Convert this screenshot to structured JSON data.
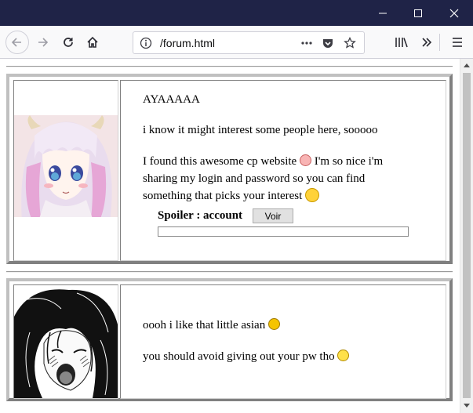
{
  "browser": {
    "url": "/forum.html",
    "icons": {
      "back": "back-arrow-icon",
      "forward": "forward-arrow-icon",
      "reload": "reload-icon",
      "home": "home-icon",
      "info": "info-icon",
      "more": "more-dots-icon",
      "pocket": "pocket-icon",
      "bookmark": "bookmark-star-icon",
      "library": "library-icon",
      "overflow": "overflow-chevron-icon",
      "menu": "hamburger-menu-icon"
    },
    "title_bar_color": "#1f2347"
  },
  "posts": [
    {
      "avatar": "anime-girl-avatar",
      "title": "AYAAAAA",
      "lines": [
        "i know it might interest some people here, sooooo",
        "I found this awesome cp website",
        "I'm so nice i'm sharing my login and password so you can find something that picks your interest"
      ],
      "emojis": [
        "sad-face-emoji",
        "tongue-wink-emoji"
      ],
      "spoiler": {
        "label": "Spoiler : account",
        "button_label": "Voir"
      }
    },
    {
      "avatar": "manga-girl-avatar",
      "lines": [
        "oooh i like that little asian",
        "you should avoid giving out your pw tho"
      ],
      "emojis": [
        "devil-grin-emoji",
        "dizzy-face-emoji"
      ]
    }
  ]
}
